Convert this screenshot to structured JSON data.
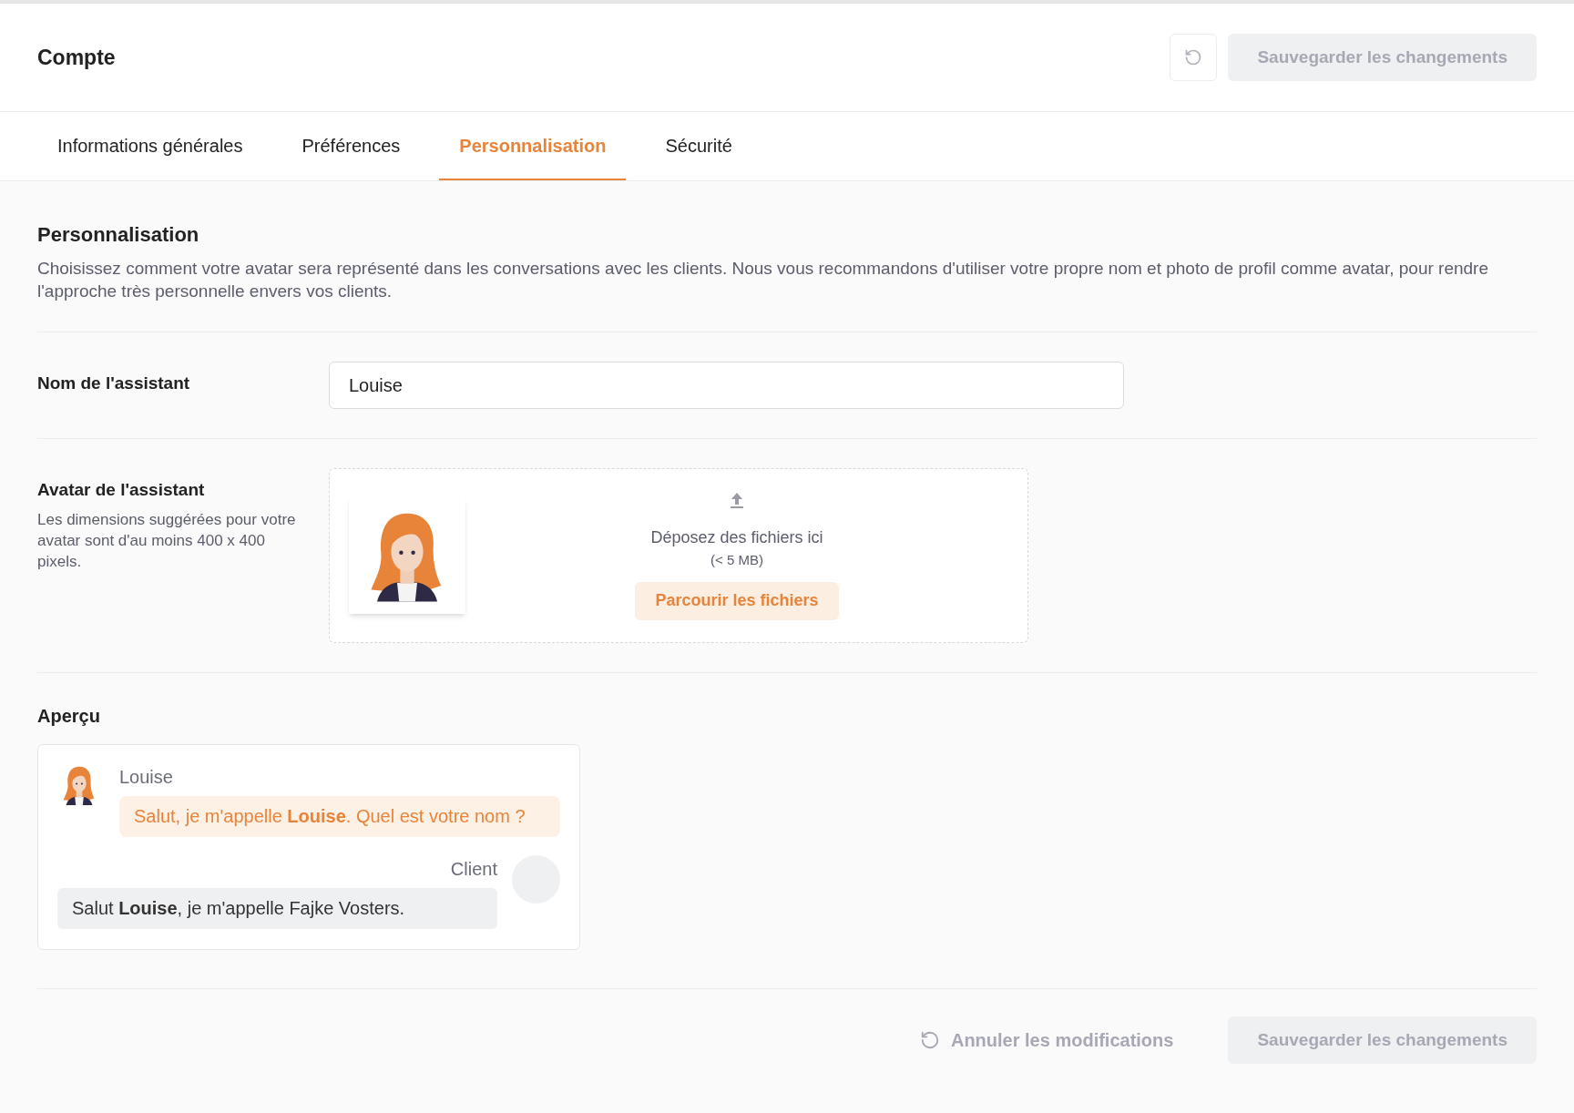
{
  "header": {
    "title": "Compte",
    "undo_button": {
      "disabled": true
    },
    "save_button": {
      "label": "Sauvegarder les changements",
      "disabled": true
    }
  },
  "tabs": [
    {
      "label": "Informations générales",
      "selected": false
    },
    {
      "label": "Préférences",
      "selected": false
    },
    {
      "label": "Personnalisation",
      "selected": true
    },
    {
      "label": "Sécurité",
      "selected": false
    }
  ],
  "section": {
    "title": "Personnalisation",
    "description": "Choisissez comment votre avatar sera représenté dans les conversations avec les clients. Nous vous recommandons d'utiliser votre propre nom et photo de profil comme avatar, pour rendre l'approche très personnelle envers vos clients."
  },
  "name_field": {
    "label": "Nom de l'assistant",
    "value": "Louise"
  },
  "avatar_field": {
    "label": "Avatar de l'assistant",
    "hint": "Les dimensions suggérées pour votre avatar sont d'au moins 400 x 400 pixels.",
    "dropzone": {
      "text": "Déposez des fichiers ici",
      "limit": "(< 5 MB)",
      "browse_button": "Parcourir les fichiers"
    }
  },
  "preview": {
    "title": "Aperçu",
    "messages": [
      {
        "kind": "assistant",
        "sender": "Louise",
        "text": "Salut, je m'appelle **Louise**. Quel est votre nom ?"
      },
      {
        "kind": "client",
        "sender": "Client",
        "text": "Salut **Louise**, je m'appelle Fajke Vosters."
      }
    ]
  },
  "footer": {
    "cancel_button": {
      "label": "Annuler les modifications",
      "disabled": true
    },
    "save_button": {
      "label": "Sauvegarder les changements",
      "disabled": true
    }
  }
}
